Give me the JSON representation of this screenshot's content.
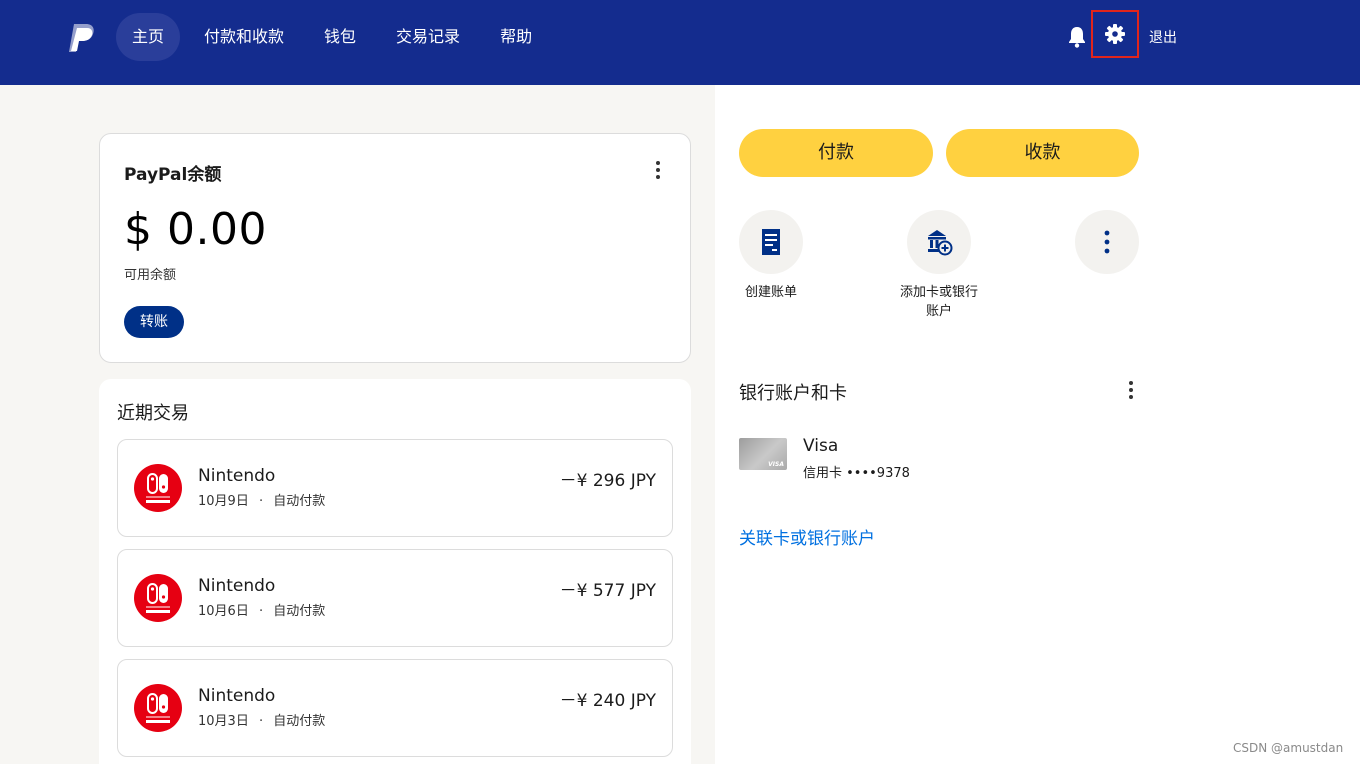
{
  "header": {
    "nav": [
      "主页",
      "付款和收款",
      "钱包",
      "交易记录",
      "帮助"
    ],
    "logout_label": "退出"
  },
  "balance": {
    "title": "PayPal余额",
    "amount": "$ 0.00",
    "available_label": "可用余额",
    "transfer_label": "转账"
  },
  "recent": {
    "title": "近期交易",
    "items": [
      {
        "merchant": "Nintendo",
        "date": "10月9日",
        "type": "自动付款",
        "amount": "－¥ 296 JPY"
      },
      {
        "merchant": "Nintendo",
        "date": "10月6日",
        "type": "自动付款",
        "amount": "－¥ 577 JPY"
      },
      {
        "merchant": "Nintendo",
        "date": "10月3日",
        "type": "自动付款",
        "amount": "－¥ 240 JPY"
      }
    ],
    "meta_separator": "·"
  },
  "actions": {
    "pay_label": "付款",
    "receive_label": "收款",
    "create_invoice_label": "创建账单",
    "add_card_label": "添加卡或银行账户"
  },
  "wallet": {
    "title": "银行账户和卡",
    "card_brand": "Visa",
    "card_detail": "信用卡 ••••9378",
    "card_image_text": "VISA",
    "link_label": "关联卡或银行账户"
  },
  "watermark": "CSDN @amustdan",
  "colors": {
    "header_bg": "#142c8e",
    "primary_button": "#003087",
    "pill_yellow": "#ffd140",
    "link_blue": "#0070e0",
    "nintendo_red": "#e60012",
    "highlight_box": "#e1251b"
  },
  "icons": [
    "paypal-logo",
    "bell-icon",
    "gear-icon",
    "kebab-icon",
    "invoice-icon",
    "bank-add-icon",
    "nintendo-switch-icon"
  ]
}
